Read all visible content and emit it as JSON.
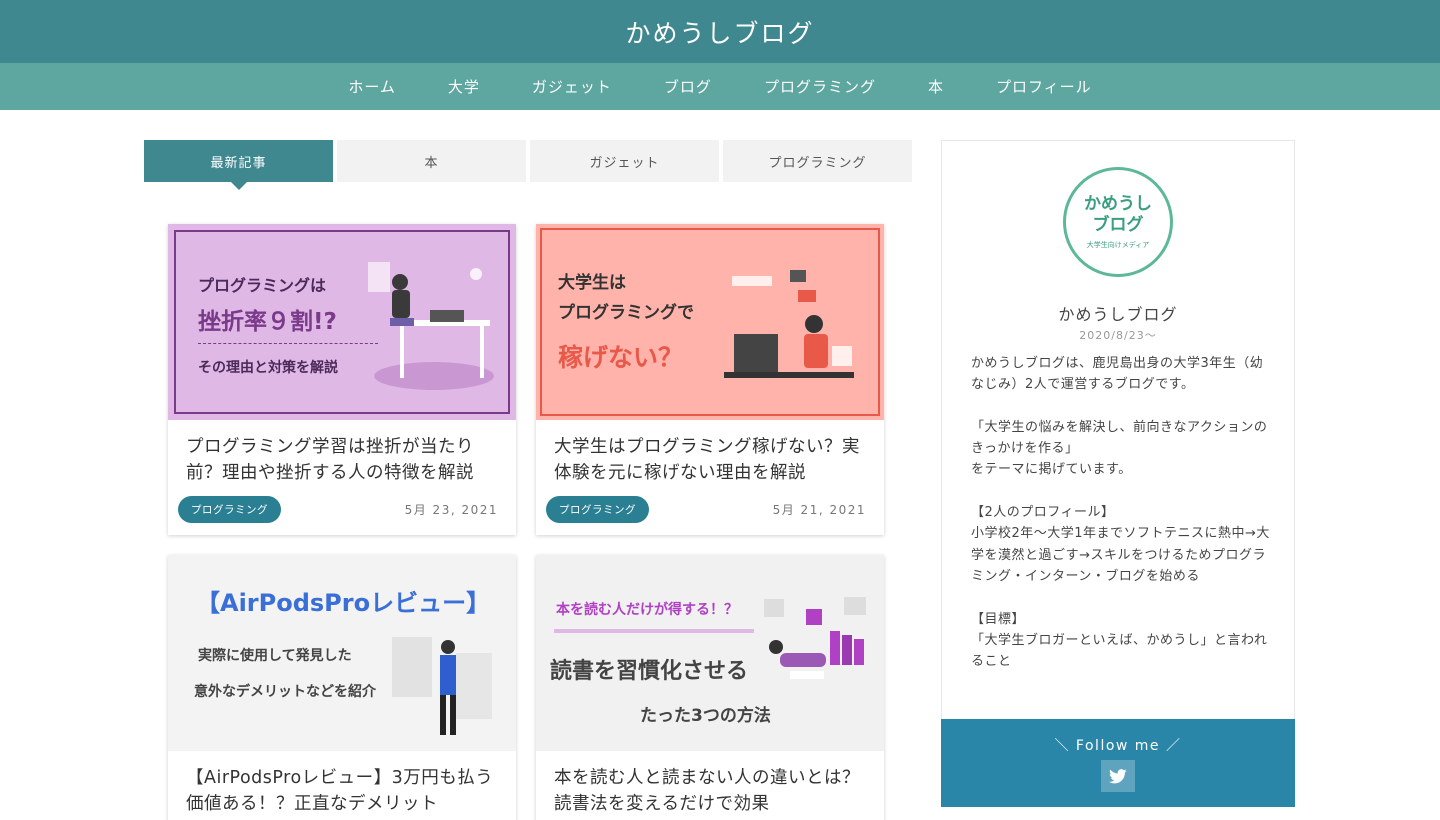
{
  "header": {
    "site_title": "かめうしブログ"
  },
  "nav": {
    "items": [
      {
        "label": "ホーム"
      },
      {
        "label": "大学"
      },
      {
        "label": "ガジェット"
      },
      {
        "label": "ブログ"
      },
      {
        "label": "プログラミング"
      },
      {
        "label": "本"
      },
      {
        "label": "プロフィール"
      }
    ]
  },
  "tabs": [
    {
      "label": "最新記事",
      "active": true
    },
    {
      "label": "本"
    },
    {
      "label": "ガジェット"
    },
    {
      "label": "プログラミング"
    }
  ],
  "cards": [
    {
      "title": "プログラミング学習は挫折が当たり前？理由や挫折する人の特徴を解説",
      "category": "プログラミング",
      "date": "5月 23, 2021",
      "thumb": {
        "line1": "プログラミングは",
        "line2": "挫折率９割!?",
        "line3": "その理由と対策を解説",
        "bg": "#e0b8e6",
        "accent": "#7a3a8a"
      }
    },
    {
      "title": "大学生はプログラミング稼げない？実体験を元に稼げない理由を解説",
      "category": "プログラミング",
      "date": "5月 21, 2021",
      "thumb": {
        "line1": "大学生は",
        "line2": "プログラミングで",
        "line3": "稼げない？",
        "bg": "#ffb3aa",
        "accent": "#e8594a"
      }
    },
    {
      "title": "【AirPodsProレビュー】3万円も払う価値ある！？正直なデメリット",
      "thumb": {
        "line1": "【AirPodsProレビュー】",
        "line2": "実際に使用して発見した",
        "line3": "意外なデメリットなどを紹介",
        "bg": "#f3f3f3",
        "accent": "#3a6fd8"
      }
    },
    {
      "title": "本を読む人と読まない人の違いとは？読書法を変えるだけで効果",
      "thumb": {
        "line1": "本を読む人だけが得する！？",
        "line2": "読書を習慣化させる",
        "line3": "たった3つの方法",
        "bg": "#f1f1f1",
        "accent": "#b041c4"
      }
    }
  ],
  "sidebar": {
    "logo_main": "かめうし\nブログ",
    "logo_sub": "大学生向けメディア",
    "name": "かめうしブログ",
    "since": "2020/8/23〜",
    "bio": "かめうしブログは、鹿児島出身の大学3年生（幼なじみ）2人で運営するブログです。\n\n「大学生の悩みを解決し、前向きなアクションのきっかけを作る」\nをテーマに掲げています。\n\n【2人のプロフィール】\n小学校2年〜大学1年までソフトテニスに熱中→大学を漠然と過ごす→スキルをつけるためプログラミング・インターン・ブログを始める\n\n【目標】\n「大学生ブロガーといえば、かめうし」と言われること",
    "follow_label": "＼ Follow me ／",
    "twitter_icon": "twitter-icon"
  },
  "colors": {
    "header": "#3f8890",
    "nav": "#5ea7a0",
    "badge": "#2a7f93",
    "follow": "#2a86a8"
  }
}
